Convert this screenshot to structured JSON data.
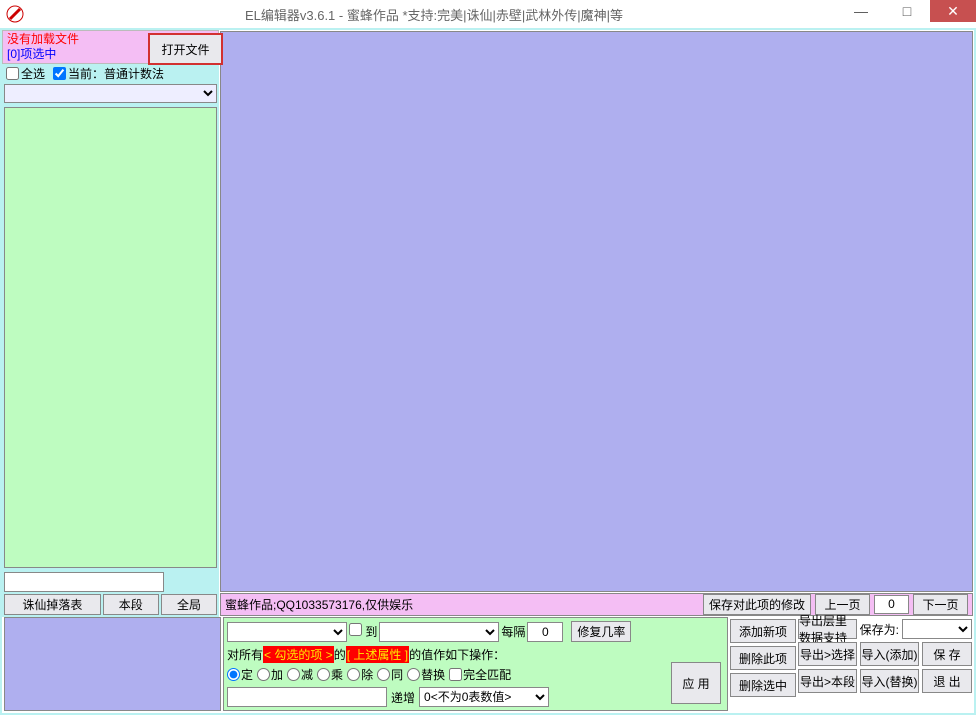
{
  "window": {
    "title": "EL编辑器v3.6.1  -  蜜蜂作品   *支持:完美|诛仙|赤壁|武林外传|魔神|等"
  },
  "left": {
    "status_noload": "没有加载文件",
    "status_sel": "[0]项选中",
    "chk_all": "全选",
    "chk_current": "当前：普通计数法",
    "open_file": "打开文件",
    "btn_drop": "诛仙掉落表",
    "btn_seg": "本段",
    "btn_global": "全局"
  },
  "pinkbar": {
    "credit": "蜜蜂作品;QQ1033573176,仅供娱乐",
    "save_changes": "保存对此项的修改",
    "prev": "上一页",
    "pageno": "0",
    "next": "下一页"
  },
  "green": {
    "to_label": "到",
    "every_label": "每隔",
    "every_val": "0",
    "fixrate": "修复几率",
    "line2_pre": "对所有",
    "line2_red1": "< 勾选的项 >",
    "line2_mid": " 的 ",
    "line2_red2": "[ 上述属性  ]",
    "line2_post": "的值作如下操作：",
    "op_set": "定",
    "op_add": "加",
    "op_sub": "减",
    "op_mul": "乘",
    "op_div": "除",
    "op_same": "同",
    "op_replace": "替换",
    "op_fullmatch": "完全匹配",
    "inc_label": "递增",
    "zero_rule": "0<不为0表数值>",
    "apply": "应 用"
  },
  "btns": {
    "add_item": "添加新项",
    "del_item": "删除此项",
    "del_sel": "删除选中",
    "export_support": "导出层里数据支持",
    "save_as": "保存为:",
    "export_sel": "导出>选择",
    "import_add": "导入(添加)",
    "export_seg": "导出>本段",
    "import_repl": "导入(替换)",
    "save": "保 存",
    "exit": "退 出"
  }
}
